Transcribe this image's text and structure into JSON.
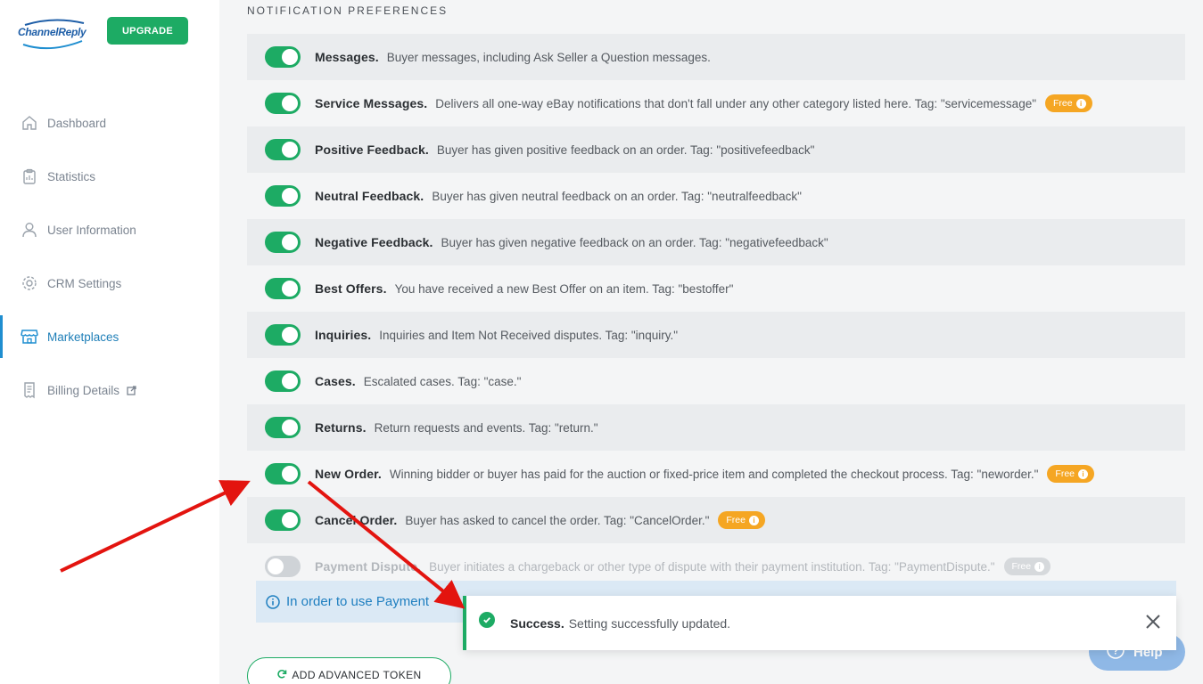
{
  "sidebar": {
    "logo_text": "ChannelReply",
    "upgrade_label": "UPGRADE",
    "items": [
      {
        "label": "Dashboard",
        "icon": "home-icon"
      },
      {
        "label": "Statistics",
        "icon": "clipboard-icon"
      },
      {
        "label": "User Information",
        "icon": "user-icon"
      },
      {
        "label": "CRM Settings",
        "icon": "gear-icon"
      },
      {
        "label": "Marketplaces",
        "icon": "store-icon"
      },
      {
        "label": "Billing Details",
        "icon": "receipt-icon"
      }
    ],
    "active_item": "Marketplaces"
  },
  "main": {
    "section_title": "NOTIFICATION PREFERENCES",
    "rows": [
      {
        "title": "Messages.",
        "desc": "Buyer messages, including Ask Seller a Question messages.",
        "enabled": true,
        "badge": ""
      },
      {
        "title": "Service Messages.",
        "desc": "Delivers all one-way eBay notifications that don't fall under any other category listed here. Tag: \"servicemessage\"",
        "enabled": true,
        "badge": "Free"
      },
      {
        "title": "Positive Feedback.",
        "desc": "Buyer has given positive feedback on an order. Tag: \"positivefeedback\"",
        "enabled": true,
        "badge": ""
      },
      {
        "title": "Neutral Feedback.",
        "desc": "Buyer has given neutral feedback on an order. Tag: \"neutralfeedback\"",
        "enabled": true,
        "badge": ""
      },
      {
        "title": "Negative Feedback.",
        "desc": "Buyer has given negative feedback on an order. Tag: \"negativefeedback\"",
        "enabled": true,
        "badge": ""
      },
      {
        "title": "Best Offers.",
        "desc": "You have received a new Best Offer on an item. Tag: \"bestoffer\"",
        "enabled": true,
        "badge": ""
      },
      {
        "title": "Inquiries.",
        "desc": "Inquiries and Item Not Received disputes. Tag: \"inquiry.\"",
        "enabled": true,
        "badge": ""
      },
      {
        "title": "Cases.",
        "desc": "Escalated cases. Tag: \"case.\"",
        "enabled": true,
        "badge": ""
      },
      {
        "title": "Returns.",
        "desc": "Return requests and events. Tag: \"return.\"",
        "enabled": true,
        "badge": ""
      },
      {
        "title": "New Order.",
        "desc": "Winning bidder or buyer has paid for the auction or fixed-price item and completed the checkout process. Tag: \"neworder.\"",
        "enabled": true,
        "badge": "Free"
      },
      {
        "title": "Cancel Order.",
        "desc": "Buyer has asked to cancel the order. Tag: \"CancelOrder.\"",
        "enabled": true,
        "badge": "Free"
      },
      {
        "title": "Payment Dispute.",
        "desc": "Buyer initiates a chargeback or other type of dispute with their payment institution. Tag: \"PaymentDispute.\"",
        "enabled": false,
        "badge": "Free"
      }
    ],
    "info_text": "In order to use Payment",
    "token_button": "ADD ADVANCED TOKEN",
    "help_label": "Help"
  },
  "toast": {
    "title": "Success.",
    "message": "Setting successfully updated."
  },
  "colors": {
    "accent_green": "#1dab64",
    "badge_orange": "#f5a623",
    "link_blue": "#1f7fc0",
    "annotation_red": "#e3140f"
  }
}
